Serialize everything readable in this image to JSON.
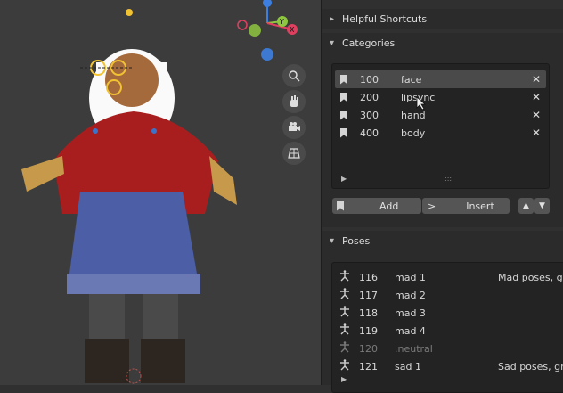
{
  "panels": {
    "helpful_shortcuts": "Helpful Shortcuts",
    "categories": "Categories",
    "poses": "Poses"
  },
  "categories": [
    {
      "number": "100",
      "name": "face"
    },
    {
      "number": "200",
      "name": "lipsync"
    },
    {
      "number": "300",
      "name": "hand"
    },
    {
      "number": "400",
      "name": "body"
    }
  ],
  "buttons": {
    "add": "Add",
    "insert": "Insert"
  },
  "poses": [
    {
      "number": "116",
      "name": "mad 1",
      "desc": "Mad poses, gro"
    },
    {
      "number": "117",
      "name": "mad 2",
      "desc": ""
    },
    {
      "number": "118",
      "name": "mad 3",
      "desc": ""
    },
    {
      "number": "119",
      "name": "mad 4",
      "desc": ""
    },
    {
      "number": "120",
      "name": ".neutral",
      "desc": ""
    },
    {
      "number": "121",
      "name": "sad 1",
      "desc": "Sad poses, gro"
    }
  ],
  "gizmo": {
    "z": "Z",
    "y": "Y",
    "x": "X"
  }
}
